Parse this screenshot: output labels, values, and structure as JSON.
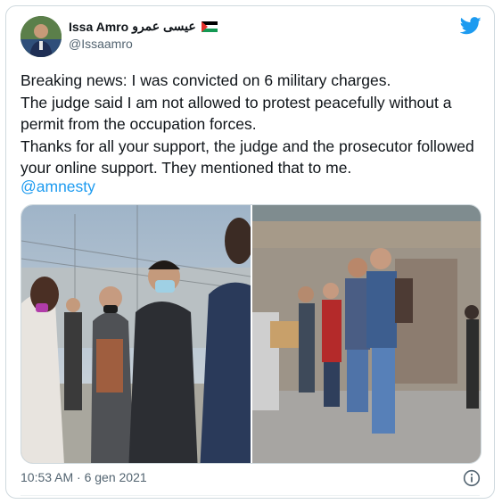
{
  "tweet": {
    "display_name": "Issa Amro",
    "arabic_name": "عيسى عمرو",
    "handle": "@Issaamro",
    "text": "Breaking news: I was convicted on 6 military charges.\nThe judge said I am not allowed to protest peacefully without a permit from the occupation forces.\nThanks for all your support, the judge and the prosecutor followed your online support. They mentioned that to me.",
    "mention": "@amnesty",
    "timestamp": "10:53 AM · 6 gen 2021"
  },
  "icons": {
    "brand": "twitter-bird-icon",
    "flag": "palestine-flag-icon",
    "info": "info-icon"
  },
  "colors": {
    "accent": "#1d9bf0",
    "text": "#0f1419",
    "secondary_text": "#536471",
    "border": "#cfd9de"
  }
}
